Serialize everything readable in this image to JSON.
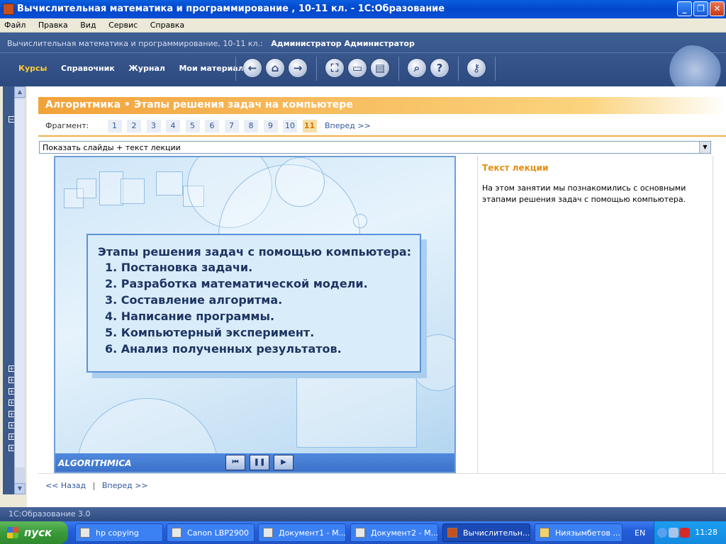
{
  "window": {
    "title": "Вычислительная математика и программирование , 10-11 кл. - 1С:Образование",
    "minimize": "_",
    "maximize": "❐",
    "close": "✕"
  },
  "menu": [
    "Файл",
    "Правка",
    "Вид",
    "Сервис",
    "Справка"
  ],
  "header": {
    "context": "Вычислительная математика и программирование, 10-11 кл.:",
    "user": "Администратор Администратор",
    "tabs": [
      "Курсы",
      "Справочник",
      "Журнал",
      "Мои материалы"
    ],
    "active_tab": "Курсы"
  },
  "toolbar_icons": [
    "back-icon",
    "home-icon",
    "forward-icon",
    "fullscreen-icon",
    "presentation-icon",
    "print-icon",
    "search-icon",
    "help-icon",
    "settings-key-icon"
  ],
  "section": {
    "title": "Алгоритмика • Этапы решения задач на компьютере",
    "fragment_label": "Фрагмент:",
    "fragments": [
      "1",
      "2",
      "3",
      "4",
      "5",
      "6",
      "7",
      "8",
      "9",
      "10",
      "11"
    ],
    "active_fragment": "11",
    "forward": "Вперед >>"
  },
  "view_select": {
    "value": "Показать слайды + текст лекции"
  },
  "slide": {
    "heading": "Этапы решения задач с помощью компьютера:",
    "steps": [
      "1. Постановка задачи.",
      "2. Разработка математической модели.",
      "3. Составление алгоритма.",
      "4. Написание программы.",
      "5. Компьютерный эксперимент.",
      "6. Анализ полученных результатов."
    ],
    "brand": "ALGORITHMICA",
    "controls": {
      "first": "⏮",
      "pause": "❚❚",
      "play": "▶"
    }
  },
  "lecture": {
    "title": "Текст лекции",
    "body": "На этом занятии мы познакомились с основными этапами решения задач с помощью компьютера."
  },
  "bottom_nav": {
    "back": "<< Назад",
    "separator": "|",
    "forward": "Вперед >>"
  },
  "status": "1С:Образование 3.0",
  "taskbar": {
    "start": "пуск",
    "tasks": [
      "hp copying",
      "Canon LBP2900",
      "Документ1 - М...",
      "Документ2 - М...",
      "Вычислительн...",
      "Ниязымбетов ..."
    ],
    "active_task": "Вычислительн...",
    "lang": "EN",
    "clock": "11:28"
  },
  "colors": {
    "accent_orange": "#f2a23a",
    "header_blue": "#2d4a7f",
    "link_blue": "#31579c",
    "slide_text": "#1e3561"
  }
}
